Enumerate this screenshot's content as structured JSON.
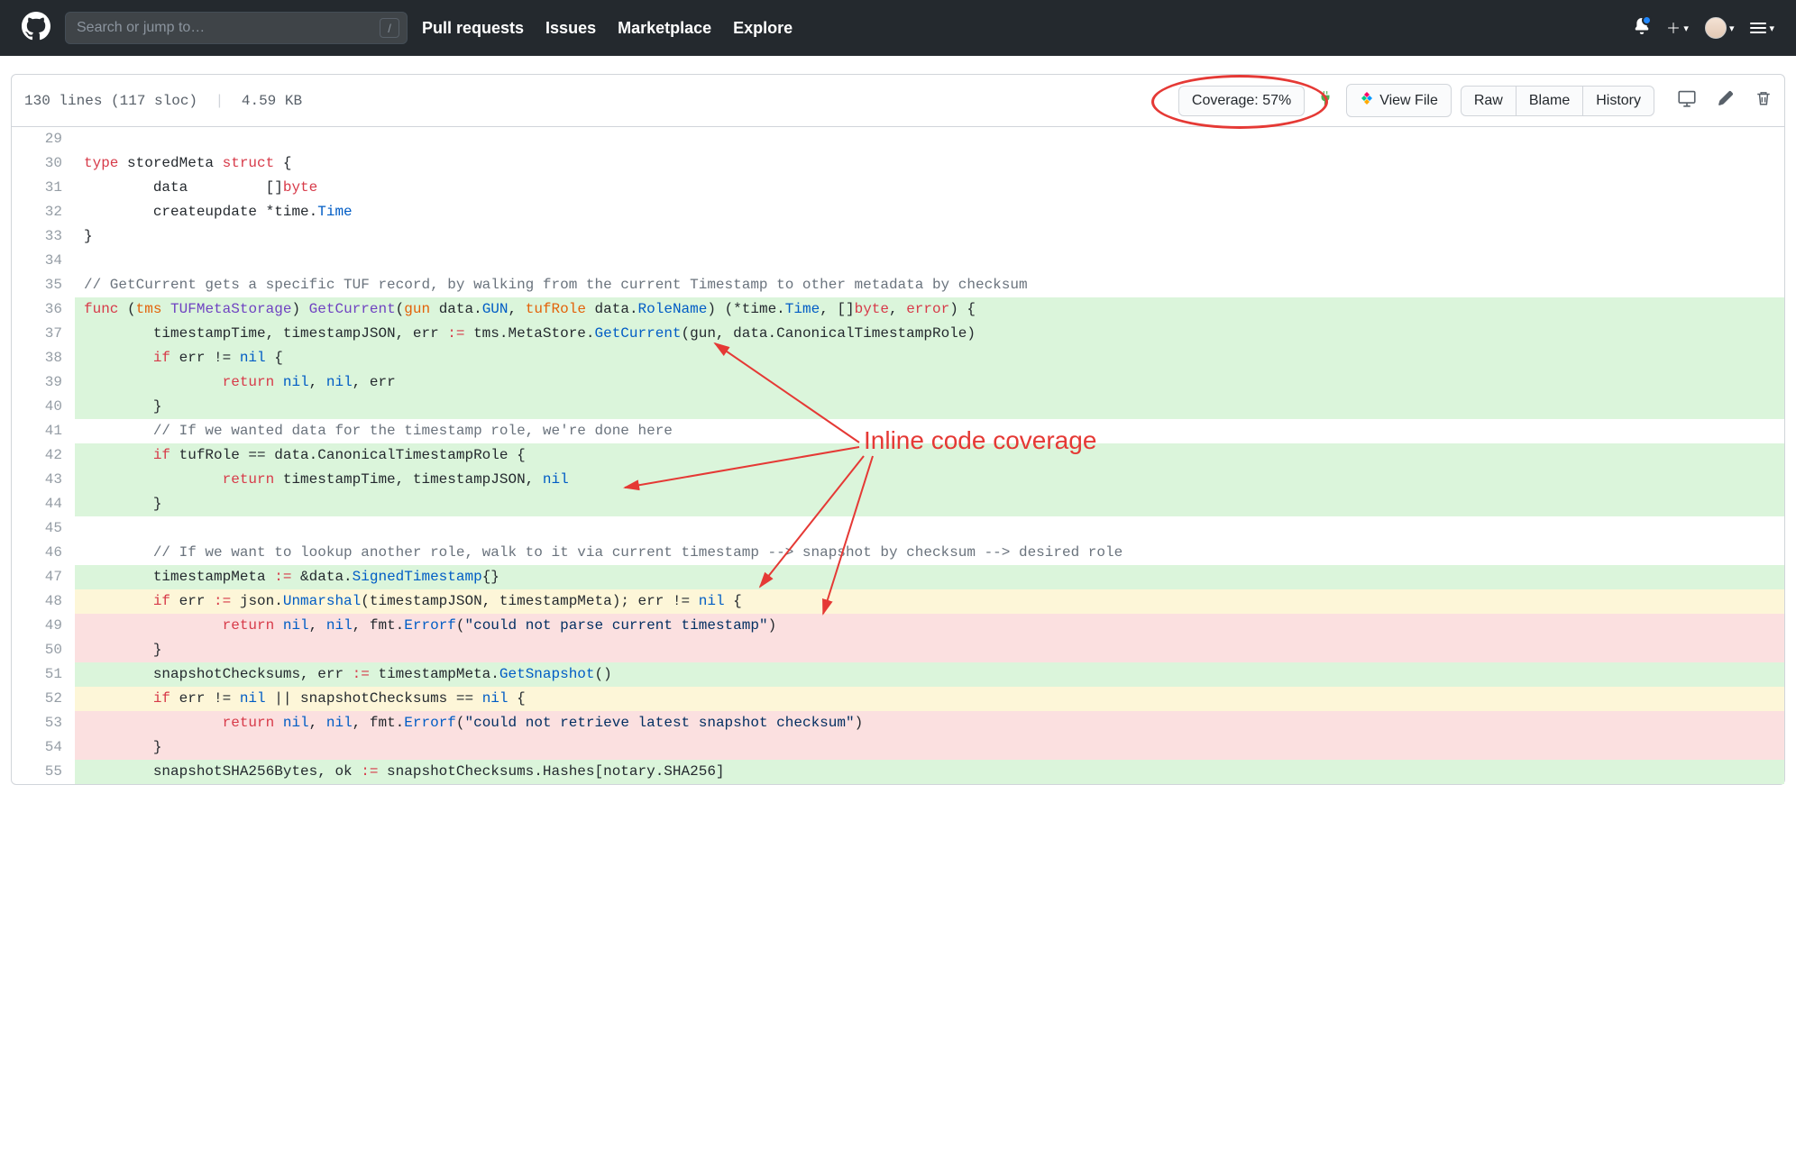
{
  "header": {
    "search_placeholder": "Search or jump to…",
    "slash": "/",
    "nav": {
      "pulls": "Pull requests",
      "issues": "Issues",
      "marketplace": "Marketplace",
      "explore": "Explore"
    }
  },
  "file": {
    "lines": "130 lines (117 sloc)",
    "size": "4.59 KB",
    "coverage_label": "Coverage: 57%",
    "view_file": "View File",
    "raw": "Raw",
    "blame": "Blame",
    "history": "History"
  },
  "annotation": {
    "label": "Inline code coverage"
  },
  "code": [
    {
      "n": 29,
      "cov": "",
      "tokens": []
    },
    {
      "n": 30,
      "cov": "",
      "tokens": [
        {
          "c": "k-red",
          "t": "type"
        },
        {
          "t": " storedMeta "
        },
        {
          "c": "k-red",
          "t": "struct"
        },
        {
          "t": " {"
        }
      ]
    },
    {
      "n": 31,
      "cov": "",
      "tokens": [
        {
          "t": "        data         []"
        },
        {
          "c": "k-red",
          "t": "byte"
        }
      ]
    },
    {
      "n": 32,
      "cov": "",
      "tokens": [
        {
          "t": "        createupdate *time."
        },
        {
          "c": "k-blue",
          "t": "Time"
        }
      ]
    },
    {
      "n": 33,
      "cov": "",
      "tokens": [
        {
          "t": "}"
        }
      ]
    },
    {
      "n": 34,
      "cov": "",
      "tokens": []
    },
    {
      "n": 35,
      "cov": "",
      "tokens": [
        {
          "c": "k-gray",
          "t": "// GetCurrent gets a specific TUF record, by walking from the current Timestamp to other metadata by checksum"
        }
      ]
    },
    {
      "n": 36,
      "cov": "green",
      "tokens": [
        {
          "c": "k-red",
          "t": "func"
        },
        {
          "t": " ("
        },
        {
          "c": "k-orange",
          "t": "tms"
        },
        {
          "t": " "
        },
        {
          "c": "k-purple",
          "t": "TUFMetaStorage"
        },
        {
          "t": ") "
        },
        {
          "c": "k-purple",
          "t": "GetCurrent"
        },
        {
          "t": "("
        },
        {
          "c": "k-orange",
          "t": "gun"
        },
        {
          "t": " data."
        },
        {
          "c": "k-blue",
          "t": "GUN"
        },
        {
          "t": ", "
        },
        {
          "c": "k-orange",
          "t": "tufRole"
        },
        {
          "t": " data."
        },
        {
          "c": "k-blue",
          "t": "RoleName"
        },
        {
          "t": ") (*time."
        },
        {
          "c": "k-blue",
          "t": "Time"
        },
        {
          "t": ", []"
        },
        {
          "c": "k-red",
          "t": "byte"
        },
        {
          "t": ", "
        },
        {
          "c": "k-red",
          "t": "error"
        },
        {
          "t": ") {"
        }
      ]
    },
    {
      "n": 37,
      "cov": "green",
      "tokens": [
        {
          "t": "        timestampTime, timestampJSON, err "
        },
        {
          "c": "k-red",
          "t": ":="
        },
        {
          "t": " tms.MetaStore."
        },
        {
          "c": "k-blue",
          "t": "GetCurrent"
        },
        {
          "t": "(gun, data.CanonicalTimestampRole)"
        }
      ]
    },
    {
      "n": 38,
      "cov": "green",
      "tokens": [
        {
          "t": "        "
        },
        {
          "c": "k-red",
          "t": "if"
        },
        {
          "t": " err != "
        },
        {
          "c": "k-blue",
          "t": "nil"
        },
        {
          "t": " {"
        }
      ]
    },
    {
      "n": 39,
      "cov": "green",
      "tokens": [
        {
          "t": "                "
        },
        {
          "c": "k-red",
          "t": "return"
        },
        {
          "t": " "
        },
        {
          "c": "k-blue",
          "t": "nil"
        },
        {
          "t": ", "
        },
        {
          "c": "k-blue",
          "t": "nil"
        },
        {
          "t": ", err"
        }
      ]
    },
    {
      "n": 40,
      "cov": "green",
      "tokens": [
        {
          "t": "        }"
        }
      ]
    },
    {
      "n": 41,
      "cov": "",
      "tokens": [
        {
          "t": "        "
        },
        {
          "c": "k-gray",
          "t": "// If we wanted data for the timestamp role, we're done here"
        }
      ]
    },
    {
      "n": 42,
      "cov": "green",
      "tokens": [
        {
          "t": "        "
        },
        {
          "c": "k-red",
          "t": "if"
        },
        {
          "t": " tufRole == data.CanonicalTimestampRole {"
        }
      ]
    },
    {
      "n": 43,
      "cov": "green",
      "tokens": [
        {
          "t": "                "
        },
        {
          "c": "k-red",
          "t": "return"
        },
        {
          "t": " timestampTime, timestampJSON, "
        },
        {
          "c": "k-blue",
          "t": "nil"
        }
      ]
    },
    {
      "n": 44,
      "cov": "green",
      "tokens": [
        {
          "t": "        }"
        }
      ]
    },
    {
      "n": 45,
      "cov": "",
      "tokens": []
    },
    {
      "n": 46,
      "cov": "",
      "tokens": [
        {
          "t": "        "
        },
        {
          "c": "k-gray",
          "t": "// If we want to lookup another role, walk to it via current timestamp --> snapshot by checksum --> desired role"
        }
      ]
    },
    {
      "n": 47,
      "cov": "green",
      "tokens": [
        {
          "t": "        timestampMeta "
        },
        {
          "c": "k-red",
          "t": ":="
        },
        {
          "t": " &data."
        },
        {
          "c": "k-blue",
          "t": "SignedTimestamp"
        },
        {
          "t": "{}"
        }
      ]
    },
    {
      "n": 48,
      "cov": "yellow",
      "tokens": [
        {
          "t": "        "
        },
        {
          "c": "k-red",
          "t": "if"
        },
        {
          "t": " err "
        },
        {
          "c": "k-red",
          "t": ":="
        },
        {
          "t": " json."
        },
        {
          "c": "k-blue",
          "t": "Unmarshal"
        },
        {
          "t": "(timestampJSON, timestampMeta); err != "
        },
        {
          "c": "k-blue",
          "t": "nil"
        },
        {
          "t": " {"
        }
      ]
    },
    {
      "n": 49,
      "cov": "red",
      "tokens": [
        {
          "t": "                "
        },
        {
          "c": "k-red",
          "t": "return"
        },
        {
          "t": " "
        },
        {
          "c": "k-blue",
          "t": "nil"
        },
        {
          "t": ", "
        },
        {
          "c": "k-blue",
          "t": "nil"
        },
        {
          "t": ", fmt."
        },
        {
          "c": "k-blue",
          "t": "Errorf"
        },
        {
          "t": "("
        },
        {
          "c": "k-navy",
          "t": "\"could not parse current timestamp\""
        },
        {
          "t": ")"
        }
      ]
    },
    {
      "n": 50,
      "cov": "red",
      "tokens": [
        {
          "t": "        }"
        }
      ]
    },
    {
      "n": 51,
      "cov": "green",
      "tokens": [
        {
          "t": "        snapshotChecksums, err "
        },
        {
          "c": "k-red",
          "t": ":="
        },
        {
          "t": " timestampMeta."
        },
        {
          "c": "k-blue",
          "t": "GetSnapshot"
        },
        {
          "t": "()"
        }
      ]
    },
    {
      "n": 52,
      "cov": "yellow",
      "tokens": [
        {
          "t": "        "
        },
        {
          "c": "k-red",
          "t": "if"
        },
        {
          "t": " err != "
        },
        {
          "c": "k-blue",
          "t": "nil"
        },
        {
          "t": " || snapshotChecksums == "
        },
        {
          "c": "k-blue",
          "t": "nil"
        },
        {
          "t": " {"
        }
      ]
    },
    {
      "n": 53,
      "cov": "red",
      "tokens": [
        {
          "t": "                "
        },
        {
          "c": "k-red",
          "t": "return"
        },
        {
          "t": " "
        },
        {
          "c": "k-blue",
          "t": "nil"
        },
        {
          "t": ", "
        },
        {
          "c": "k-blue",
          "t": "nil"
        },
        {
          "t": ", fmt."
        },
        {
          "c": "k-blue",
          "t": "Errorf"
        },
        {
          "t": "("
        },
        {
          "c": "k-navy",
          "t": "\"could not retrieve latest snapshot checksum\""
        },
        {
          "t": ")"
        }
      ]
    },
    {
      "n": 54,
      "cov": "red",
      "tokens": [
        {
          "t": "        }"
        }
      ]
    },
    {
      "n": 55,
      "cov": "green",
      "tokens": [
        {
          "t": "        snapshotSHA256Bytes, ok "
        },
        {
          "c": "k-red",
          "t": ":="
        },
        {
          "t": " snapshotChecksums.Hashes[notary.SHA256]"
        }
      ]
    }
  ]
}
